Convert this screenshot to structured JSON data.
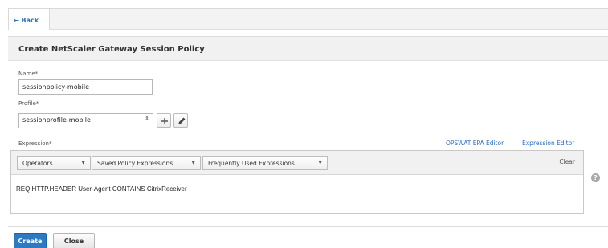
{
  "nav": {
    "back_label": "← Back"
  },
  "panel": {
    "title": "Create NetScaler Gateway Session Policy"
  },
  "form": {
    "name_label": "Name*",
    "name_value": "sessionpolicy-mobile",
    "profile_label": "Profile*",
    "profile_value": "sessionprofile-mobile",
    "expression_label": "Expression*",
    "opswat_link": "OPSWAT EPA Editor",
    "expression_editor_link": "Expression Editor",
    "toolbar": {
      "operators": "Operators",
      "saved": "Saved Policy Expressions",
      "frequent": "Frequently Used Expressions",
      "clear": "Clear"
    },
    "expression_value": "REQ.HTTP.HEADER User-Agent CONTAINS CitrixReceiver"
  },
  "actions": {
    "create": "Create",
    "close": "Close"
  },
  "colors": {
    "primary": "#2b7bc4",
    "link": "#2a6ebb"
  }
}
